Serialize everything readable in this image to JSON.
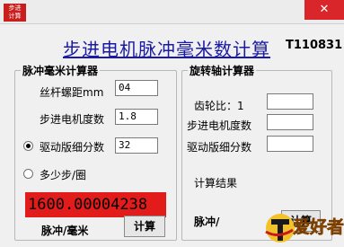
{
  "window": {
    "icon_text": "步进\n计算",
    "close_glyph": "✕"
  },
  "header": {
    "title": "步进电机脉冲毫米数计算",
    "model": "T110831"
  },
  "left_panel": {
    "legend": "脉冲毫米计算器",
    "screw_pitch_label": "丝杆螺距mm",
    "screw_pitch_value": "04",
    "step_angle_label": "步进电机度数",
    "step_angle_value": "1.8",
    "microstep_label": "驱动版细分数",
    "microstep_value": "32",
    "steps_per_rev_label": "多少步/圈",
    "result_value": "1600.00004238",
    "unit_label": "脉冲/毫米",
    "calc_button": "计算"
  },
  "right_panel": {
    "legend": "旋转轴计算器",
    "gear_ratio_label": "齿轮比：1",
    "step_angle_label": "步进电机度数",
    "microstep_label": "驱动版细分数",
    "result_label": "计算结果",
    "unit_label": "脉冲/",
    "calc_button": "计算"
  },
  "watermark": {
    "text": "爱好者"
  },
  "colors": {
    "title": "#1a1aa6",
    "result_bg": "#e21b1b",
    "close": "#d9262b"
  }
}
